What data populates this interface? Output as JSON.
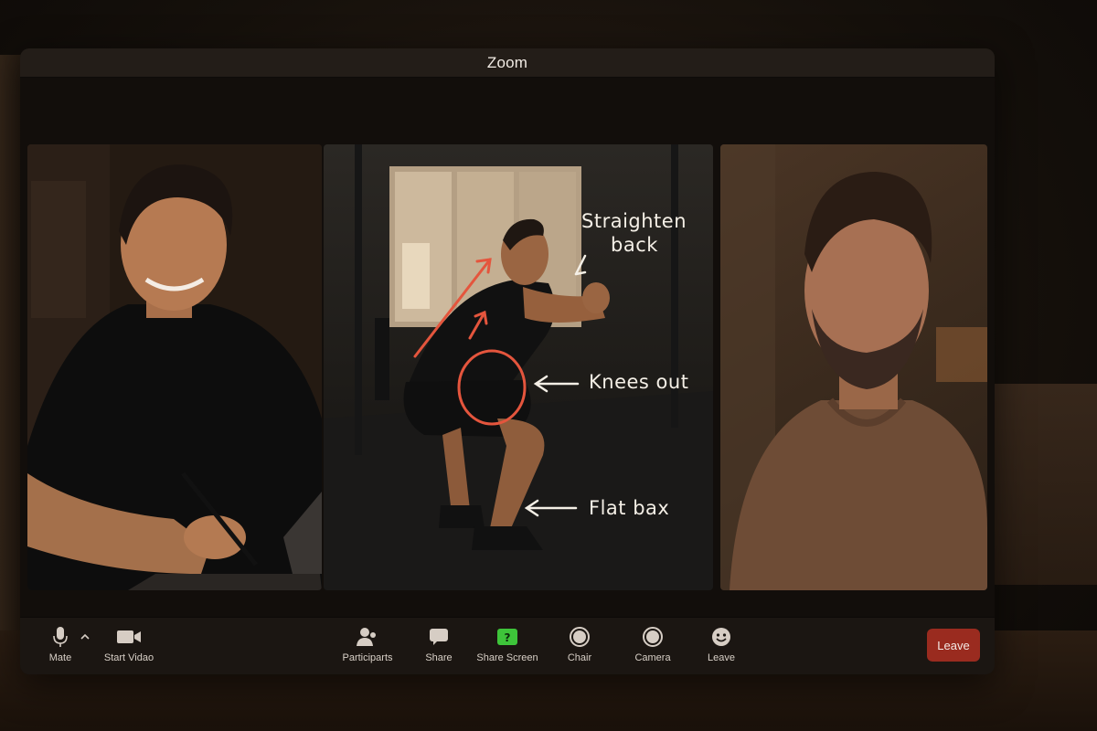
{
  "window": {
    "title": "Zoom"
  },
  "annotations": {
    "straighten_back_line1": "Straighten",
    "straighten_back_line2": "back",
    "knees_out": "Knees out",
    "flat_back": "Flat bax"
  },
  "colors": {
    "annotation_stroke": "#e4553d",
    "leave_button": "#9a2b1f",
    "share_screen_icon": "#3ec43a"
  },
  "toolbar": {
    "mute_label": "Mate",
    "start_video_label": "Start Vidao",
    "participants_label": "Participarts",
    "share_label": "Share",
    "share_screen_label": "Share Screen",
    "chat_label": "Chair",
    "camera_label": "Camera",
    "reactions_label": "Leave",
    "leave_button_label": "Leave",
    "icons": {
      "mute": "microphone-icon",
      "mute_options": "chevron-up-icon",
      "start_video": "video-camera-icon",
      "participants": "participants-icon",
      "share": "chat-bubble-icon",
      "share_screen": "share-screen-icon",
      "chat": "record-circle-icon",
      "camera": "record-circle-icon",
      "reactions": "emoji-icon"
    }
  }
}
